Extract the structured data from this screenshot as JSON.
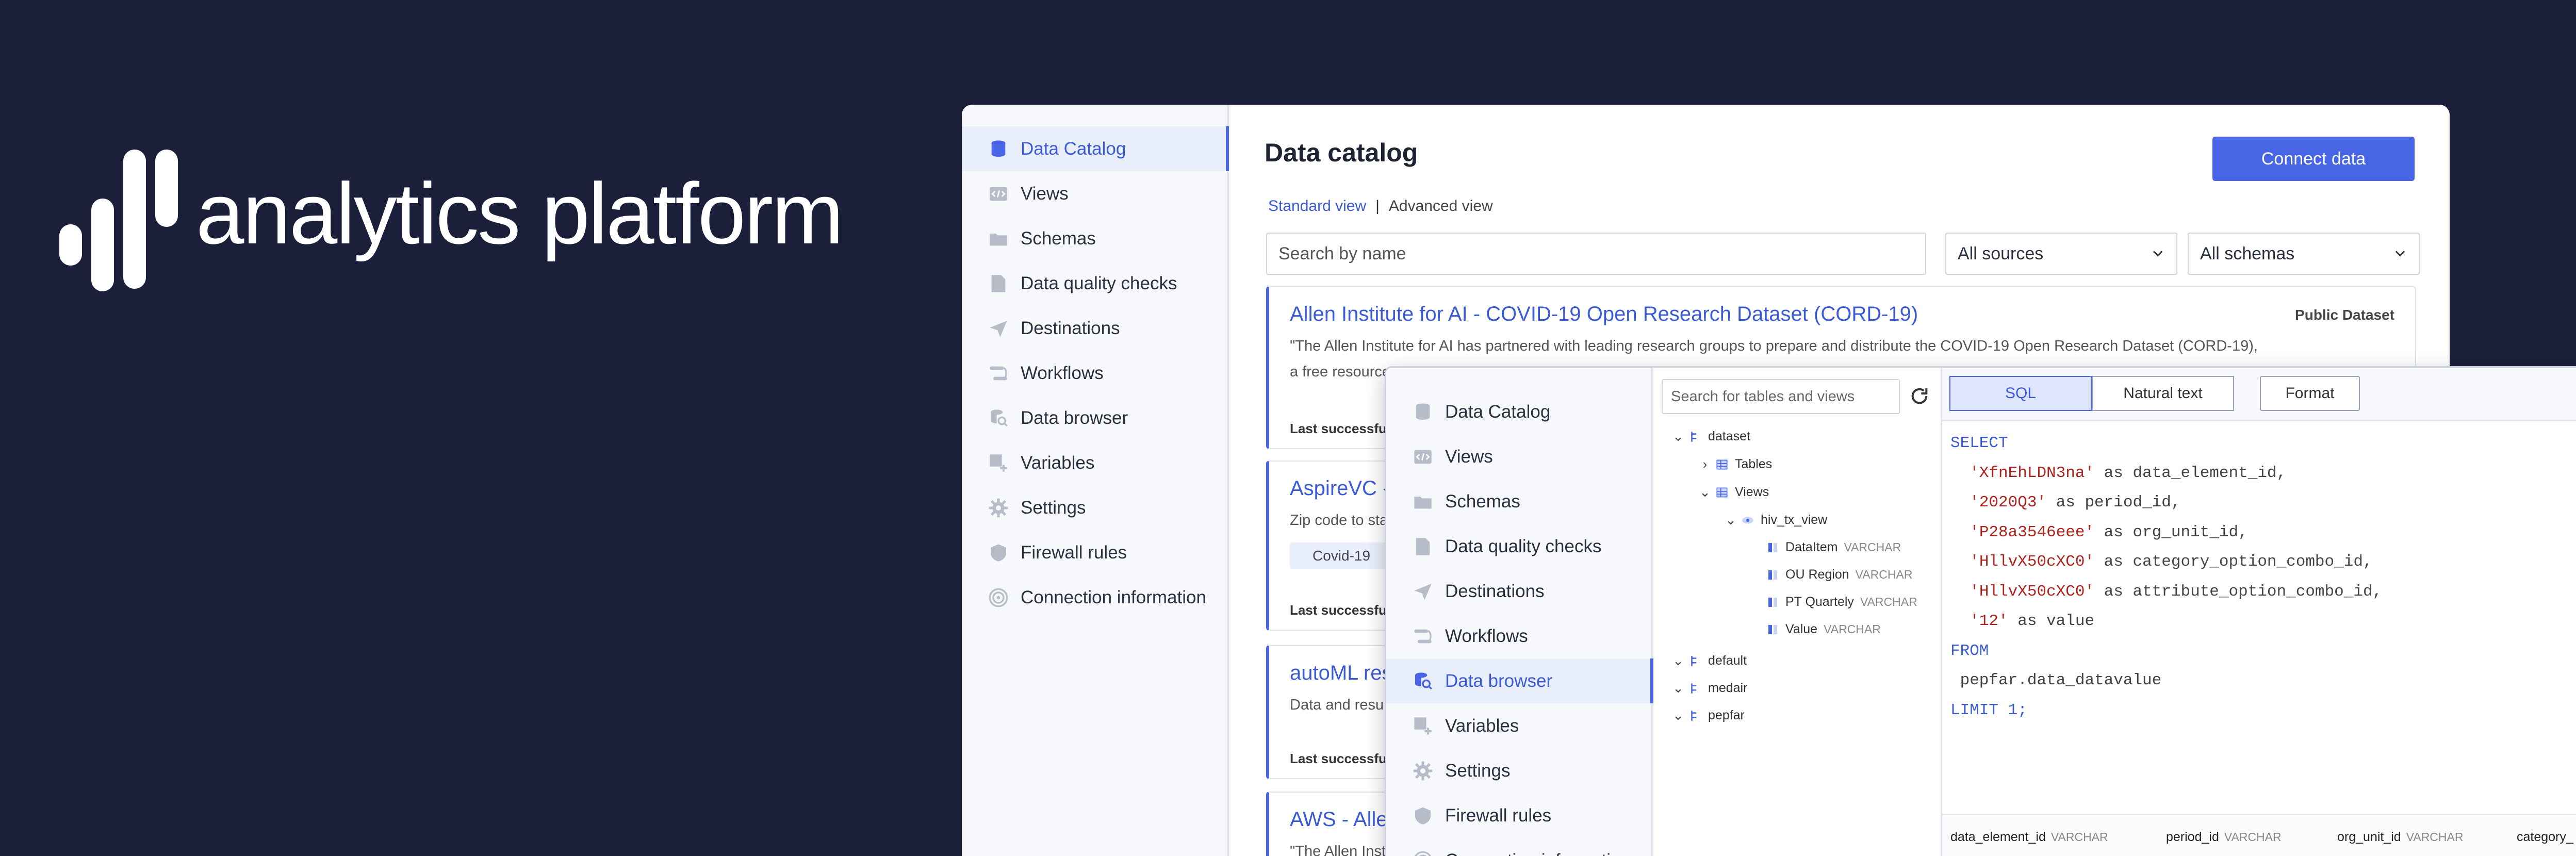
{
  "brand": {
    "name": "analytics platform"
  },
  "nav_items": [
    {
      "label": "Data Catalog",
      "icon": "database-icon"
    },
    {
      "label": "Views",
      "icon": "code-view-icon"
    },
    {
      "label": "Schemas",
      "icon": "folder-icon"
    },
    {
      "label": "Data quality checks",
      "icon": "document-icon"
    },
    {
      "label": "Destinations",
      "icon": "send-icon"
    },
    {
      "label": "Workflows",
      "icon": "workflow-icon"
    },
    {
      "label": "Data browser",
      "icon": "database-search-icon"
    },
    {
      "label": "Variables",
      "icon": "variables-icon"
    },
    {
      "label": "Settings",
      "icon": "gear-icon"
    },
    {
      "label": "Firewall rules",
      "icon": "shield-icon"
    },
    {
      "label": "Connection information",
      "icon": "broadcast-icon"
    }
  ],
  "catalog": {
    "title": "Data catalog",
    "connect_label": "Connect data",
    "view_standard": "Standard view",
    "view_separator": "|",
    "view_advanced": "Advanced view",
    "search_placeholder": "Search by name",
    "sources_filter": "All sources",
    "schemas_filter": "All schemas",
    "cards": [
      {
        "title": "Allen Institute for AI - COVID-19 Open Research Dataset (CORD-19)",
        "badge": "Public Dataset",
        "desc_line1": "\"The Allen Institute for AI has partnered with leading research groups to prepare and distribute the COVID-19 Open Research Dataset (CORD-19),",
        "desc_line2": "a free resource",
        "meta": "Last successful"
      },
      {
        "title": "AspireVC -",
        "desc_line1": "Zip code to sta",
        "tag": "Covid-19",
        "meta": "Last successful"
      },
      {
        "title": "autoML res",
        "desc_line1": "Data and resul",
        "meta": "Last successful"
      },
      {
        "title": "AWS - Allen",
        "desc_line1": "\"The Allen Inst"
      }
    ]
  },
  "browser": {
    "search_placeholder": "Search for tables and views",
    "tree": {
      "dataset": "dataset",
      "tables": "Tables",
      "views": "Views",
      "view_name": "hiv_tx_view",
      "columns": [
        {
          "name": "DataItem",
          "type": "VARCHAR"
        },
        {
          "name": "OU Region",
          "type": "VARCHAR"
        },
        {
          "name": "PT Quartely",
          "type": "VARCHAR"
        },
        {
          "name": "Value",
          "type": "VARCHAR"
        }
      ],
      "default": "default",
      "medair": "medair",
      "pepfar": "pepfar"
    },
    "editor": {
      "tab_sql": "SQL",
      "tab_natural": "Natural text",
      "format_label": "Format",
      "sql_select": "SELECT",
      "sql_lines": [
        {
          "str": "'XfnEhLDN3na'",
          "rest": " as data_element_id,"
        },
        {
          "str": "'2020Q3'",
          "rest": " as period_id,"
        },
        {
          "str": "'P28a3546eee'",
          "rest": " as org_unit_id,"
        },
        {
          "str": "'HllvX50cXC0'",
          "rest": " as category_option_combo_id,"
        },
        {
          "str": "'HllvX50cXC0'",
          "rest": " as attribute_option_combo_id,"
        },
        {
          "str": "'12'",
          "rest": " as value"
        }
      ],
      "sql_from": "FROM",
      "sql_table": " pepfar.data_datavalue",
      "sql_limit": "LIMIT 1;"
    },
    "results_columns": [
      {
        "name": "data_element_id",
        "type": "VARCHAR"
      },
      {
        "name": "period_id",
        "type": "VARCHAR"
      },
      {
        "name": "org_unit_id",
        "type": "VARCHAR"
      },
      {
        "name": "category_",
        "type": ""
      }
    ]
  },
  "colors": {
    "background": "#1c1f3a",
    "accent": "#4865e6",
    "sql_string": "#b0241f"
  }
}
